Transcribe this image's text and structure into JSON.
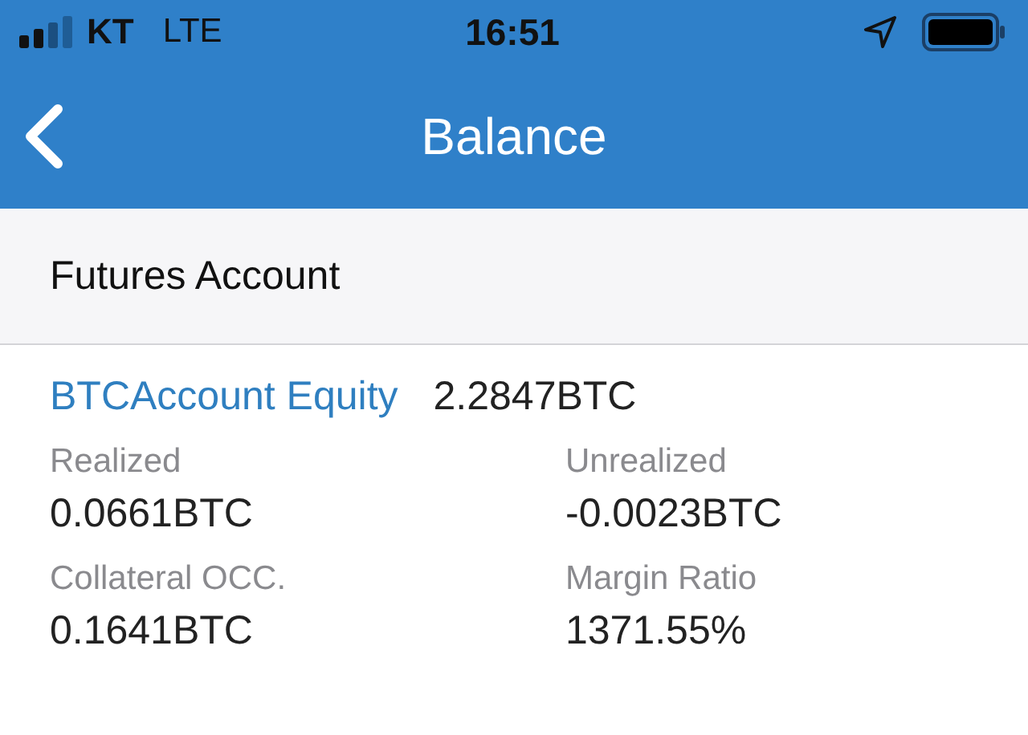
{
  "status_bar": {
    "carrier": "KT",
    "network": "LTE",
    "time": "16:51"
  },
  "nav": {
    "title": "Balance"
  },
  "section": {
    "title": "Futures Account"
  },
  "equity": {
    "label": "BTCAccount Equity",
    "value": "2.2847BTC"
  },
  "metrics": [
    {
      "label": "Realized",
      "value": "0.0661BTC"
    },
    {
      "label": "Unrealized",
      "value": "-0.0023BTC"
    },
    {
      "label": "Collateral OCC.",
      "value": "0.1641BTC"
    },
    {
      "label": "Margin Ratio",
      "value": "1371.55%"
    }
  ]
}
